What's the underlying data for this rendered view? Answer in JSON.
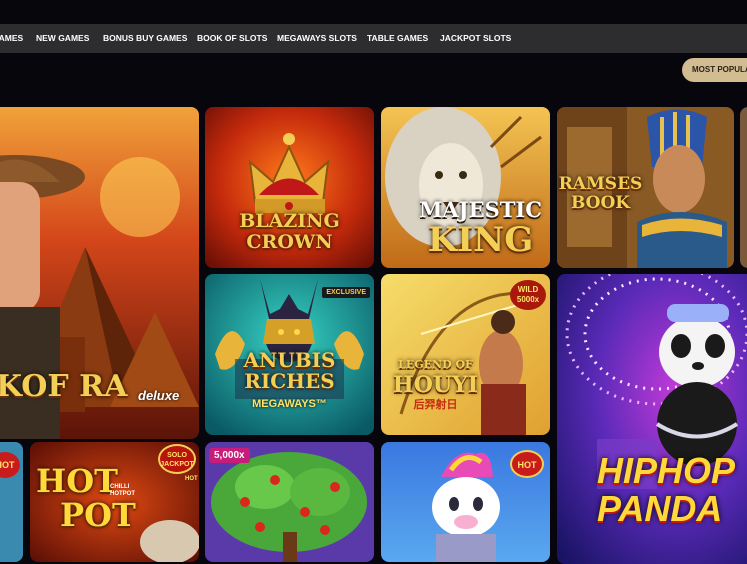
{
  "nav": {
    "items": [
      "GAMES",
      "NEW GAMES",
      "BONUS BUY GAMES",
      "BOOK OF SLOTS",
      "MEGAWAYS SLOTS",
      "TABLE GAMES",
      "JACKPOT SLOTS"
    ]
  },
  "sort": {
    "label": "MOST POPULAR"
  },
  "tiles": {
    "book_of_ra": {
      "title": "OF RA",
      "sub": "deluxe",
      "prefix": "K"
    },
    "blazing_crown": {
      "line1": "BLAZING",
      "line2": "CROWN"
    },
    "majestic_king": {
      "line1": "MAJESTIC",
      "line2": "KING"
    },
    "ramses_book": {
      "line1": "RAMSES",
      "line2": "BOOK"
    },
    "anubis_riches": {
      "badge": "EXCLUSIVE",
      "line1": "ANUBIS",
      "line2": "RICHES",
      "line3": "MEGAWAYS™"
    },
    "legend_of_houyi": {
      "badge_top": "WILD",
      "badge_bottom": "5000x",
      "line1": "LEGEND OF",
      "line2": "HOUYI",
      "line3": "后羿射日"
    },
    "hip_hop_panda": {
      "line1": "HIPHOP",
      "line2": "PANDA"
    },
    "hot_pot": {
      "line1": "HOT",
      "line2": "POT",
      "chilli": "CHILLI HOTPOT",
      "badge_top": "SOLO",
      "badge_bottom": "JACKPOT",
      "corner": "HOT"
    },
    "money_tree": {
      "badge": "5,000x"
    },
    "unicorn": {
      "badge": "HOT"
    },
    "left_partial": {
      "badge": "HOT"
    }
  },
  "colors": {
    "background": "#07060d",
    "navbar": "#2d2d30",
    "sort_pill": "#d2bd92",
    "gold_text": "#f4cf56"
  }
}
